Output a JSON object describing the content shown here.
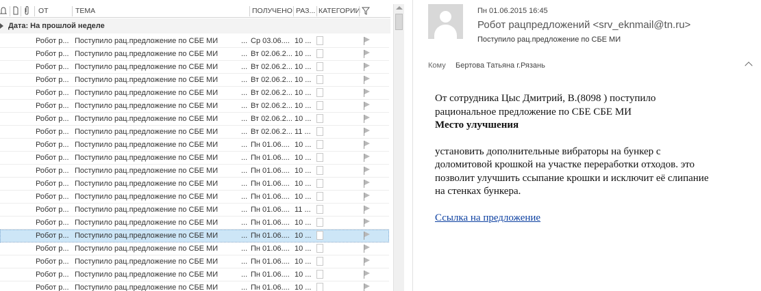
{
  "list": {
    "columns": {
      "from": "ОТ",
      "subject": "ТЕМА",
      "received": "ПОЛУЧЕНО",
      "size": "РАЗ...",
      "categories": "КАТЕГОРИИ"
    },
    "group_label": "Дата: На прошлой неделе",
    "rows": [
      {
        "from": "Робот р...",
        "subject": "Поступило рац.предложение по СБЕ МИ",
        "dots": "...",
        "received": "Ср 03.06....",
        "size": "10 ..."
      },
      {
        "from": "Робот р...",
        "subject": "Поступило рац.предложение по СБЕ МИ",
        "dots": "...",
        "received": "Вт 02.06.2...",
        "size": "10 ..."
      },
      {
        "from": "Робот р...",
        "subject": "Поступило рац.предложение по СБЕ МИ",
        "dots": "...",
        "received": "Вт 02.06.2...",
        "size": "10 ..."
      },
      {
        "from": "Робот р...",
        "subject": "Поступило рац.предложение по СБЕ МИ",
        "dots": "...",
        "received": "Вт 02.06.2...",
        "size": "10 ..."
      },
      {
        "from": "Робот р...",
        "subject": "Поступило рац.предложение по СБЕ МИ",
        "dots": "...",
        "received": "Вт 02.06.2...",
        "size": "10 ..."
      },
      {
        "from": "Робот р...",
        "subject": "Поступило рац.предложение по СБЕ МИ",
        "dots": "...",
        "received": "Вт 02.06.2...",
        "size": "10 ..."
      },
      {
        "from": "Робот р...",
        "subject": "Поступило рац.предложение по СБЕ МИ",
        "dots": "...",
        "received": "Вт 02.06.2...",
        "size": "10 ..."
      },
      {
        "from": "Робот р...",
        "subject": "Поступило рац.предложение по СБЕ МИ",
        "dots": "...",
        "received": "Вт 02.06.2...",
        "size": "11 ..."
      },
      {
        "from": "Робот р...",
        "subject": "Поступило рац.предложение по СБЕ МИ",
        "dots": "...",
        "received": "Пн 01.06....",
        "size": "10 ..."
      },
      {
        "from": "Робот р...",
        "subject": "Поступило рац.предложение по СБЕ МИ",
        "dots": "...",
        "received": "Пн 01.06....",
        "size": "10 ..."
      },
      {
        "from": "Робот р...",
        "subject": "Поступило рац.предложение по СБЕ МИ",
        "dots": "...",
        "received": "Пн 01.06....",
        "size": "10 ..."
      },
      {
        "from": "Робот р...",
        "subject": "Поступило рац.предложение по СБЕ МИ",
        "dots": "...",
        "received": "Пн 01.06....",
        "size": "10 ..."
      },
      {
        "from": "Робот р...",
        "subject": "Поступило рац.предложение по СБЕ МИ",
        "dots": "...",
        "received": "Пн 01.06....",
        "size": "10 ..."
      },
      {
        "from": "Робот р...",
        "subject": "Поступило рац.предложение по СБЕ МИ",
        "dots": "...",
        "received": "Пн 01.06....",
        "size": "11 ..."
      },
      {
        "from": "Робот р...",
        "subject": "Поступило рац.предложение по СБЕ МИ",
        "dots": "...",
        "received": "Пн 01.06....",
        "size": "10 ..."
      },
      {
        "from": "Робот р...",
        "subject": "Поступило рац.предложение по СБЕ МИ",
        "dots": "...",
        "received": "Пн 01.06....",
        "size": "10 ...",
        "selected": true
      },
      {
        "from": "Робот р...",
        "subject": "Поступило рац.предложение по СБЕ МИ",
        "dots": "...",
        "received": "Пн 01.06....",
        "size": "10 ..."
      },
      {
        "from": "Робот р...",
        "subject": "Поступило рац.предложение по СБЕ МИ",
        "dots": "...",
        "received": "Пн 01.06....",
        "size": "10 ..."
      },
      {
        "from": "Робот р...",
        "subject": "Поступило рац.предложение по СБЕ МИ",
        "dots": "...",
        "received": "Пн 01.06....",
        "size": "10 ..."
      },
      {
        "from": "Робот р...",
        "subject": "Поступило рац.предложение по СБЕ МИ",
        "dots": "...",
        "received": "Пн 01.06....",
        "size": "10 ..."
      }
    ]
  },
  "reading": {
    "date": "Пн 01.06.2015 16:45",
    "sender": "Робот рацпредложений <srv_eknmail@tn.ru>",
    "subject": "Поступило рац.предложение по СБЕ МИ",
    "to_label": "Кому",
    "to_value": "Бертова Татьяна г.Рязань",
    "body": {
      "line1": "От сотрудника Цыс Дмитрий, В.(8098 ) поступило",
      "line2": "рациональное предложение по СБЕ СБЕ МИ",
      "heading": "Место улучшения",
      "para1": "установить дополнительные вибраторы на бункер с",
      "para2": "доломитовой крошкой на участке переработки отходов. это",
      "para3": "позволит улучшить ссыпание крошки и исключит её слипание",
      "para4": "на стенках бункера.",
      "link": "Ссылка на предложение"
    }
  }
}
